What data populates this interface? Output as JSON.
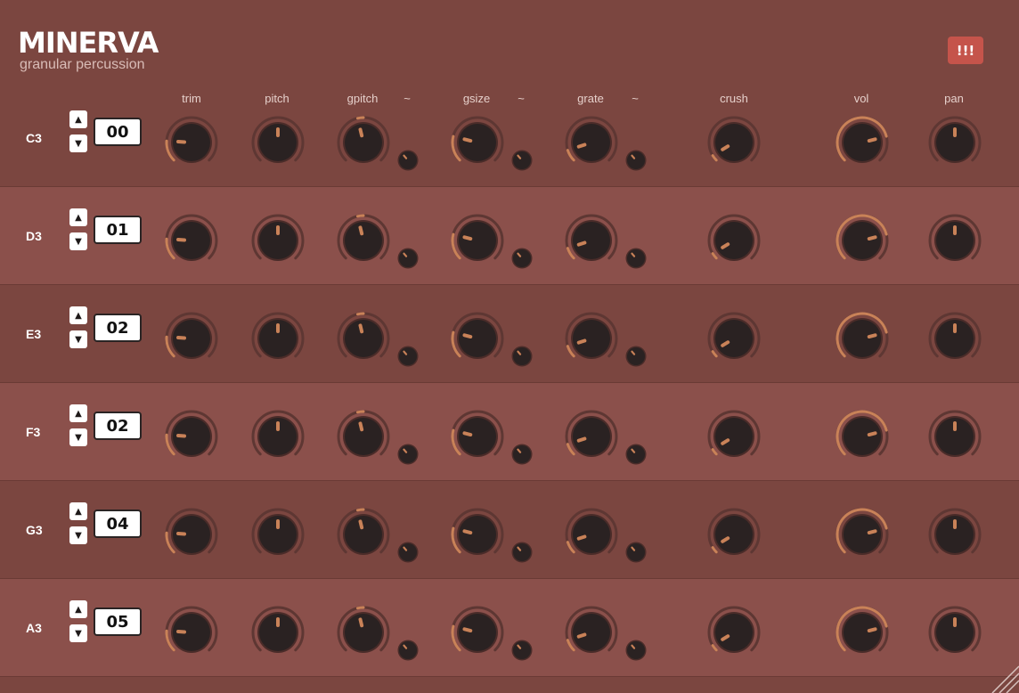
{
  "app": {
    "title": "MINERVA",
    "subtitle": "granular percussion",
    "alert_label": "!!!"
  },
  "columns": [
    {
      "key": "trim",
      "label": "trim"
    },
    {
      "key": "pitch",
      "label": "pitch"
    },
    {
      "key": "gpitch",
      "label": "gpitch"
    },
    {
      "key": "gpitch_mod",
      "label": "~"
    },
    {
      "key": "gsize",
      "label": "gsize"
    },
    {
      "key": "gsize_mod",
      "label": "~"
    },
    {
      "key": "grate",
      "label": "grate"
    },
    {
      "key": "grate_mod",
      "label": "~"
    },
    {
      "key": "crush",
      "label": "crush"
    },
    {
      "key": "vol",
      "label": "vol"
    },
    {
      "key": "pan",
      "label": "pan"
    }
  ],
  "rows": [
    {
      "note": "C3",
      "sample": "00",
      "knobs": {
        "trim": 0.18,
        "pitch": 0.5,
        "gpitch": 0.45,
        "gsize": 0.22,
        "grate": 0.1,
        "crush": 0.05,
        "vol": 0.78,
        "pan": 0.5
      },
      "mods": {
        "gpitch": 0.35,
        "gsize": 0.35,
        "grate": 0.35
      }
    },
    {
      "note": "D3",
      "sample": "01",
      "knobs": {
        "trim": 0.18,
        "pitch": 0.5,
        "gpitch": 0.45,
        "gsize": 0.22,
        "grate": 0.1,
        "crush": 0.05,
        "vol": 0.78,
        "pan": 0.5
      },
      "mods": {
        "gpitch": 0.35,
        "gsize": 0.35,
        "grate": 0.35
      }
    },
    {
      "note": "E3",
      "sample": "02",
      "knobs": {
        "trim": 0.18,
        "pitch": 0.5,
        "gpitch": 0.45,
        "gsize": 0.22,
        "grate": 0.1,
        "crush": 0.05,
        "vol": 0.78,
        "pan": 0.5
      },
      "mods": {
        "gpitch": 0.35,
        "gsize": 0.35,
        "grate": 0.35
      }
    },
    {
      "note": "F3",
      "sample": "02",
      "knobs": {
        "trim": 0.18,
        "pitch": 0.5,
        "gpitch": 0.45,
        "gsize": 0.22,
        "grate": 0.1,
        "crush": 0.05,
        "vol": 0.78,
        "pan": 0.5
      },
      "mods": {
        "gpitch": 0.35,
        "gsize": 0.35,
        "grate": 0.35
      }
    },
    {
      "note": "G3",
      "sample": "04",
      "knobs": {
        "trim": 0.18,
        "pitch": 0.5,
        "gpitch": 0.45,
        "gsize": 0.22,
        "grate": 0.1,
        "crush": 0.05,
        "vol": 0.78,
        "pan": 0.5
      },
      "mods": {
        "gpitch": 0.35,
        "gsize": 0.35,
        "grate": 0.35
      }
    },
    {
      "note": "A3",
      "sample": "05",
      "knobs": {
        "trim": 0.18,
        "pitch": 0.5,
        "gpitch": 0.45,
        "gsize": 0.22,
        "grate": 0.1,
        "crush": 0.05,
        "vol": 0.78,
        "pan": 0.5
      },
      "mods": {
        "gpitch": 0.35,
        "gsize": 0.35,
        "grate": 0.35
      }
    }
  ],
  "icons": {
    "up": "▲",
    "down": "▼"
  },
  "colors": {
    "background": "#7b4640",
    "row_alt": "#8b504b",
    "arc": "#c98258",
    "track": "#5e3733",
    "knob": "#2a2222",
    "accent": "#c5544b"
  }
}
